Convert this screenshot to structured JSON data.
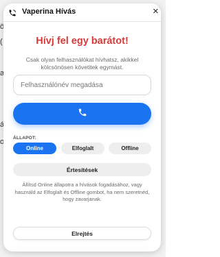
{
  "background": {
    "fragments": [
      "ö",
      "(",
      "a",
      "ás",
      "o"
    ]
  },
  "panel": {
    "title": "Vaperina Hívás",
    "close": "×",
    "phone_icon": "phone-icon"
  },
  "invite": {
    "heading": "Hívj fel egy barátot!",
    "description": "Csak olyan felhasználókat hívhatsz, akikkel kölcsönösen követitek egymást."
  },
  "username": {
    "placeholder": "Felhasználónév megadása",
    "value": ""
  },
  "call": {
    "icon": "phone-icon",
    "color": "#1a73f0"
  },
  "status": {
    "label": "ÁLLAPOT:",
    "options": [
      "Online",
      "Elfoglalt",
      "Offline"
    ],
    "selected": "Online"
  },
  "notifications": {
    "label": "Értesítések"
  },
  "hint": "Állítsd Online állapotra a hívások fogadásához, vagy használd az Elfoglalt és Offline gombot, ha nem szeretnéd, hogy zavarjanak.",
  "hide": {
    "label": "Elrejtés"
  },
  "colors": {
    "heading": "#d63a3a",
    "accent": "#1a73f0"
  }
}
